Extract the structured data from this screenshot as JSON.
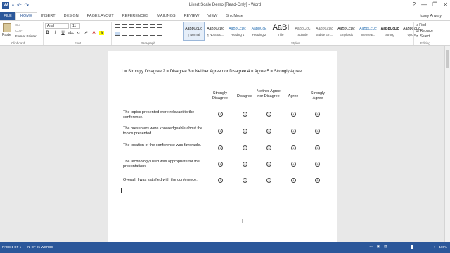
{
  "window": {
    "title": "Likert Scale Demo [Read-Only] - Word",
    "help": "?",
    "minimize": "—",
    "restore": "❐",
    "close": "✕"
  },
  "qat": {
    "logo": "W",
    "save": "▪",
    "undo": "↶",
    "redo": "↷"
  },
  "tabs": [
    "FILE",
    "HOME",
    "INSERT",
    "DESIGN",
    "PAGE LAYOUT",
    "REFERENCES",
    "MAILINGS",
    "REVIEW",
    "VIEW",
    "SnidMose"
  ],
  "active_tab": "HOME",
  "user": "Iosey Anway",
  "ribbon": {
    "clipboard": {
      "paste": "Paste",
      "cut": "Cut",
      "copy": "Copy",
      "format_painter": "Format Painter",
      "label": "Clipboard"
    },
    "font": {
      "name": "Arial",
      "size": "11",
      "label": "Font"
    },
    "paragraph": {
      "label": "Paragraph"
    },
    "styles": {
      "label": "Styles",
      "items": [
        {
          "sample": "AaBbCcDc",
          "name": "¶ Normal"
        },
        {
          "sample": "AaBbCcDc",
          "name": "¶ No Spac..."
        },
        {
          "sample": "AaBbCcDc",
          "name": "Heading 1"
        },
        {
          "sample": "AaBbCcE",
          "name": "Heading 2"
        },
        {
          "sample": "AaBI",
          "name": "Title"
        },
        {
          "sample": "AaBbCcC",
          "name": "Subtitle"
        },
        {
          "sample": "AaBbCcDc",
          "name": "Subtle Em..."
        },
        {
          "sample": "AaBbCcDc",
          "name": "Emphasis"
        },
        {
          "sample": "AaBbCcDc",
          "name": "Intense E..."
        },
        {
          "sample": "AaBbCcDc",
          "name": "Strong"
        },
        {
          "sample": "AaBbCcDc",
          "name": "Quote"
        }
      ]
    },
    "editing": {
      "find": "Find",
      "replace": "Replace",
      "select": "Select",
      "label": "Editing"
    }
  },
  "document": {
    "scale_line": "1 = Strongly Disagree  2 = Disagree  3 = Neither Agree nor Disagree  4 = Agree  5 = Strongly Agree",
    "headers": [
      "Strongly Disagree",
      "Disagree",
      "Neither Agree nor Disagree",
      "Agree",
      "Strongly Agree"
    ],
    "questions": [
      "The topics presented were relevant to the conference.",
      "The presenters were knowledgeable about the topics presented.",
      "The location of the conference was favorable.",
      "The technology used was appropriate for the presentations.",
      "Overall, I was satisfied with the conference."
    ],
    "ratings": [
      "1",
      "2",
      "3",
      "4",
      "5"
    ]
  },
  "status": {
    "page": "PAGE 1 OF 1",
    "words": "72 OF 95 WORDS",
    "zoom": "100%"
  }
}
